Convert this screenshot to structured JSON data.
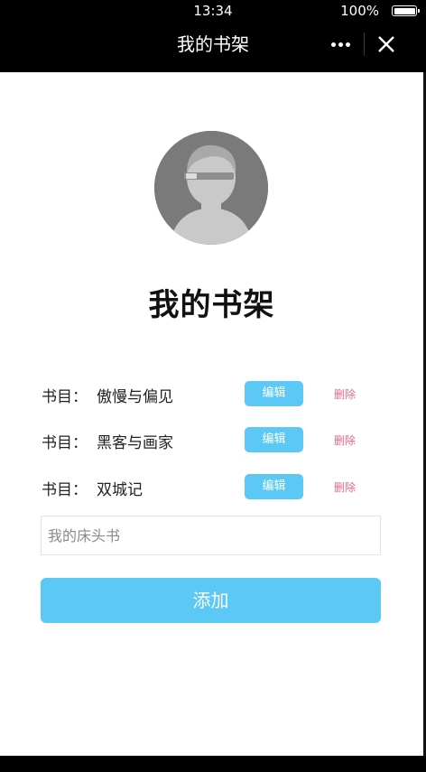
{
  "status_bar": {
    "time": "13:34",
    "battery": "100%"
  },
  "nav": {
    "title": "我的书架"
  },
  "page": {
    "title": "我的书架"
  },
  "books": [
    {
      "label": "书目：",
      "name": "傲慢与偏见",
      "edit": "编辑",
      "delete": "删除"
    },
    {
      "label": "书目：",
      "name": "黑客与画家",
      "edit": "编辑",
      "delete": "删除"
    },
    {
      "label": "书目：",
      "name": "双城记",
      "edit": "编辑",
      "delete": "删除"
    }
  ],
  "input": {
    "placeholder": "我的床头书",
    "value": ""
  },
  "add_button": {
    "label": "添加"
  },
  "colors": {
    "accent": "#5bc8f5",
    "delete": "#e8668a",
    "nav_bg": "#000000"
  }
}
